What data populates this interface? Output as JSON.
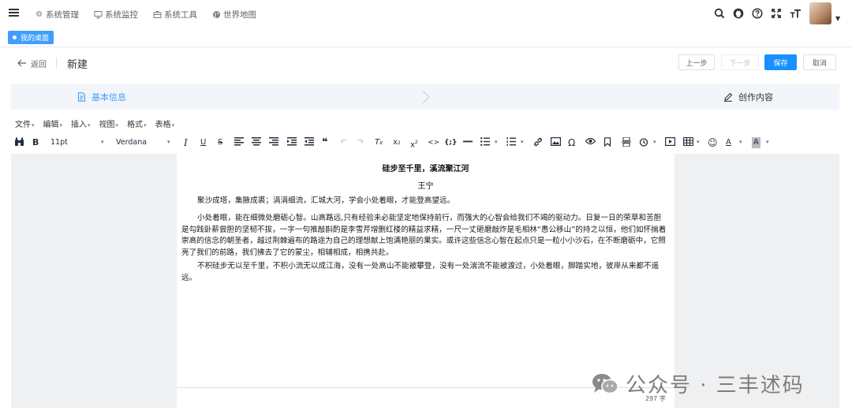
{
  "topnav": {
    "menu": [
      {
        "label": "系统管理",
        "icon": "gear-icon"
      },
      {
        "label": "系统监控",
        "icon": "monitor-icon"
      },
      {
        "label": "系统工具",
        "icon": "toolbox-icon"
      },
      {
        "label": "世界地图",
        "icon": "globe-icon"
      }
    ],
    "tools": [
      "search-icon",
      "github-icon",
      "help-icon",
      "fullscreen-icon",
      "font-size-icon"
    ]
  },
  "tags": {
    "active": "我的桌面"
  },
  "header": {
    "back_label": "返回",
    "title": "新建",
    "buttons": {
      "prev": "上一步",
      "next": "下一步",
      "save": "保存",
      "cancel": "取消"
    }
  },
  "steps": [
    {
      "label": "基本信息",
      "icon": "document-icon"
    },
    {
      "label": "创作内容",
      "icon": "pen-icon"
    }
  ],
  "editor": {
    "menus": [
      "文件",
      "编辑",
      "插入",
      "视图",
      "格式",
      "表格"
    ],
    "font_size": "11pt",
    "font_family": "Verdana",
    "content": {
      "title": "硅步至千里，溪流聚江河",
      "author": "王宁",
      "paragraphs": [
        "聚沙成塔，集腋成裘；涓涓细流，汇城大河，学会小处着眼，才能登高望远。",
        "小处着眼，能在细微处磨砺心智。山高路远,只有经验未必能坚定地保持前行，而强大的心智会给我们不竭的驱动力。日复一日的荣草和苦胆是勾践卧薪尝胆的坚韧不拔，一字一句推敲斟酌是李雪芹增删红楼的精益求精，一尺一丈砸磨敲炸是毛相林“愚公移山”的持之以恒，他们如怀揣着崇高的信念的朝圣者，越过荆棘遍布的路途为自己的理想献上饱满艳丽的果实。或许这些信念心智在起点只是一粒小小沙石，在不断磨砺中，它照亮了我们的前路，我们拂去了它的蒙尘，相辅相成，相携共赴。",
        "不积硅步无以至千里，不积小流无以成江海，没有一处高山不能被攀登，没有一处湍流不能被渡过，小处着眼，脚踏实地，彼岸从来都不遥远。"
      ]
    },
    "word_count": "297 字"
  },
  "watermark": "公众号 · 三丰述码"
}
